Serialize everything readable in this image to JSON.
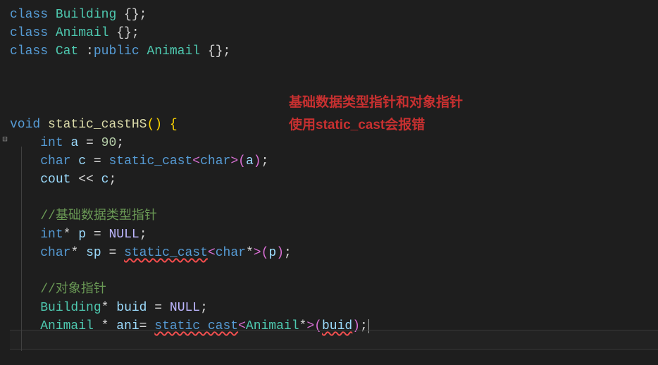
{
  "code": {
    "line1_kw_class": "class",
    "line1_type": "Building",
    "line1_rest": " {};",
    "line2_kw_class": "class",
    "line2_type": "Animail",
    "line2_rest": " {};",
    "line3_kw_class": "class",
    "line3_type_cat": "Cat",
    "line3_colon": " :",
    "line3_kw_public": "public",
    "line3_type_animail": "Animail",
    "line3_rest": " {};",
    "line_fn_kw": "void",
    "line_fn_name": "static_castHS",
    "line_fn_parens": "()",
    "line_fn_brace": " {",
    "line_int_kw": "int",
    "line_int_var": "a",
    "line_int_eq": " = ",
    "line_int_val": "90",
    "line_int_semi": ";",
    "line_char_kw": "char",
    "line_char_var": "c",
    "line_char_eq": " = ",
    "line_char_cast": "static_cast",
    "line_char_lt": "<",
    "line_char_type": "char",
    "line_char_gt": ">",
    "line_char_paren_open": "(",
    "line_char_arg": "a",
    "line_char_paren_close": ")",
    "line_char_semi": ";",
    "line_cout_var": "cout",
    "line_cout_op": " << ",
    "line_cout_arg": "c",
    "line_cout_semi": ";",
    "comment1": "//基础数据类型指针",
    "line_intp_kw": "int",
    "line_intp_star": "*",
    "line_intp_var": "p",
    "line_intp_eq": " = ",
    "line_intp_null": "NULL",
    "line_intp_semi": ";",
    "line_charp_kw": "char",
    "line_charp_star": "*",
    "line_charp_var": "sp",
    "line_charp_eq": " = ",
    "line_charp_cast": "static_cast",
    "line_charp_lt": "<",
    "line_charp_type": "char",
    "line_charp_ptr": "*",
    "line_charp_gt": ">",
    "line_charp_paren_open": "(",
    "line_charp_arg": "p",
    "line_charp_paren_close": ")",
    "line_charp_semi": ";",
    "comment2": "//对象指针",
    "line_build_type": "Building",
    "line_build_star": "*",
    "line_build_var": "buid",
    "line_build_eq": " = ",
    "line_build_null": "NULL",
    "line_build_semi": ";",
    "line_ani_type": "Animail",
    "line_ani_star": " * ",
    "line_ani_var": "ani",
    "line_ani_eq": "= ",
    "line_ani_cast": "static_cast",
    "line_ani_lt": "<",
    "line_ani_casttype": "Animail",
    "line_ani_ptr": "*",
    "line_ani_gt": ">",
    "line_ani_paren_open": "(",
    "line_ani_arg": "buid",
    "line_ani_paren_close": ")",
    "line_ani_semi": ";"
  },
  "annotation": {
    "line1": "基础数据类型指针和对象指针",
    "line2": "使用static_cast会报错"
  },
  "fold": {
    "collapse_icon": "⊟"
  }
}
